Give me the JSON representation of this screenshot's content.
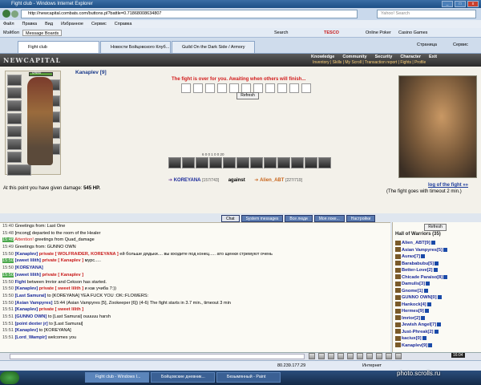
{
  "window": {
    "title": "Fight club - Windows Internet Explorer",
    "buttons": [
      "_",
      "□",
      "x"
    ]
  },
  "address": {
    "url": "http://newcapital.combats.com/buttons.pl?battle=0.71868008634807",
    "search_placeholder": "Yahoo! Search"
  },
  "menu": [
    "Файл",
    "Правка",
    "Вид",
    "Избранное",
    "Сервис",
    "Справка"
  ],
  "links_bar": {
    "mailbox": "Мэйбол",
    "message_boards": "Message Boards",
    "search": "Search",
    "tesco": "TESCO",
    "online_poker": "Online Poker",
    "casino_games": "Casino Games",
    "page": "Страница",
    "tools": "Сервис"
  },
  "tabs": [
    {
      "label": "Fight club"
    },
    {
      "label": "Новости Бойцовского Клуб..."
    },
    {
      "label": "Guild On the Dark Side / Armory"
    }
  ],
  "game": {
    "logo": "NEWCAPITAL",
    "menu": [
      "Knowledge",
      "Community",
      "Security",
      "Character",
      "Exit"
    ],
    "submenu": "Inventory | Skills | My Scroll | Transaction report | Fights | Profile",
    "char_name": "Kanaplev [9]",
    "hp": "0/680",
    "fight_msg": "The fight is over for you. Awaiting when others will finish...",
    "refresh": "Refresh",
    "skill_counts": "6   0   0   1   0   0   20",
    "me": "KOREYANA",
    "me_hp": "[157/743]",
    "vs": "against",
    "enemy": "Alien_ABT",
    "enemy_hp": "[227/719]",
    "damage_label": "At this point you have given damage:",
    "damage_value": "545 HP.",
    "log_link": "log of the fight »»",
    "goes_down": "(The fight goes with timeout 2 min.)"
  },
  "chat_tabs": [
    "Chat",
    "System messages",
    "Все люди",
    "Моя локе...",
    "Настройки"
  ],
  "chat": [
    {
      "time": "15:40",
      "text": "Greetings from: Last One"
    },
    {
      "time": "15:48",
      "text": "[mcong] departed to the room of the Healer"
    },
    {
      "time": "15:48",
      "pre": "Attention!",
      "text": " greetings from Quad_damage",
      "green": true
    },
    {
      "time": "15:49",
      "text": "Greetings from: GUNNO OWN"
    },
    {
      "time": "15:50",
      "nick": "[Kanaplev]",
      "priv": "private [ WOLFRAIDER, KOREYANA ]",
      "text": " ей больше дядьки.... вы входите под конец..... ато щенки стремуют очень"
    },
    {
      "time": "15:50",
      "nick": "[sweet lilith]",
      "priv": "private [ Kanaplev ]",
      "text": " мурс.....",
      "green": true
    },
    {
      "time": "15:50",
      "nick": "[KOREYANA]",
      "text": ""
    },
    {
      "time": "15:50",
      "nick": "[sweet lilith]",
      "priv": "private [ Kanaplev ]",
      "text": "",
      "green": true
    },
    {
      "time": "15:50",
      "nick": "Fight",
      "text": " between Imrior and Cekson has started."
    },
    {
      "time": "15:50",
      "nick": "[Kanaplev]",
      "priv": "private [ sweet lilith ]",
      "text": " и как учиба 7:))"
    },
    {
      "time": "15:50",
      "nick": "[Last Samurai]",
      "text": " to [KOREYANA] YEA FUCK YOU :OK::FLOWERS:"
    },
    {
      "time": "15:50",
      "nick": "[Asian Vampyres]",
      "text": " 15:44 (Asian Vampyres [5], Zookeeper [6]) (4-6) The fight starts in 3.7 min., timeout 3 min"
    },
    {
      "time": "15:51",
      "nick": "[Kanaplev]",
      "priv": "private [ sweet lilith ]",
      "text": ""
    },
    {
      "time": "15:51",
      "nick": "[GUNNO OWN]",
      "text": " to [Last Samurai] ouuuuu harsh"
    },
    {
      "time": "15:51",
      "nick": "[point dexter jr]",
      "text": " to [Last Samurai]"
    },
    {
      "time": "15:51",
      "nick": "[Kanaplev]",
      "text": " to [KOREYANA]"
    },
    {
      "time": "15:51",
      "nick": "[Lord_Wampir]",
      "text": " welcomes you"
    }
  ],
  "sidelist": {
    "refresh": "Refresh",
    "title": "Hall of Warriors (35)",
    "items": [
      "Alien_ABT[9]",
      "Asian Vampyres[5]",
      "Aurax[7]",
      "Barababubu[5]",
      "Better-Love[2]",
      "Chicade Paraiso[8]",
      "Damulis[3]",
      "Gnome[1]",
      "GUNNO OWN[0]",
      "Hankock[4]",
      "Hermes[9]",
      "Imrior[2]",
      "Jewish Angel[7]",
      "Just-Phreak[2]",
      "kaciux[0]",
      "Kanaplev[9]"
    ]
  },
  "chat_clock": "16:04",
  "status": {
    "ip": "80.239.177.29",
    "zone": "Интернет"
  },
  "taskbar": {
    "tasks": [
      "Fight club - Windows I...",
      "Бойцовские дневник...",
      "Безымянный - Paint"
    ],
    "clock": "16:05"
  },
  "watermark": "photo.scrolls.ru"
}
